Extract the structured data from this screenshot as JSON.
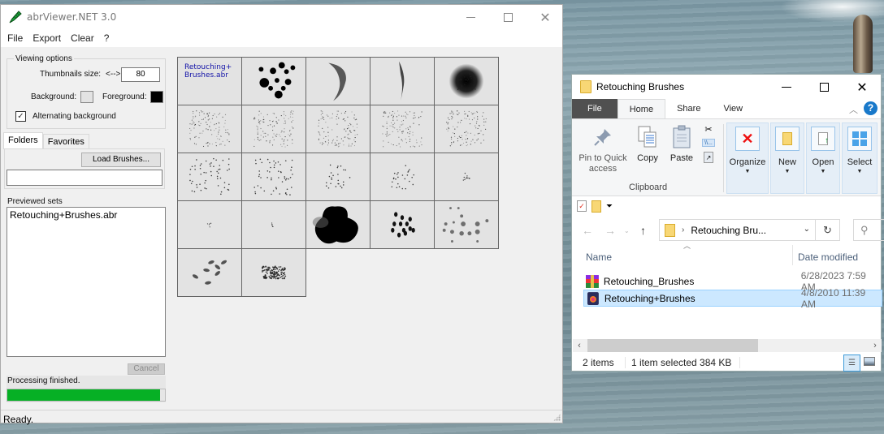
{
  "abr_viewer": {
    "title": "abrViewer.NET 3.0",
    "window_controls": {
      "minimize": "minimize",
      "maximize": "maximize",
      "close": "✕"
    },
    "menu": [
      "File",
      "Export",
      "Clear",
      "?"
    ],
    "viewing_options": {
      "legend": "Viewing options",
      "thumbnails_size_label": "Thumbnails size:",
      "thumbnails_size_arrows": "<-->",
      "thumbnails_size_value": "80",
      "background_label": "Background:",
      "background_color": "#e3e3e3",
      "foreground_label": "Foreground:",
      "foreground_color": "#000000",
      "alternating_label": "Alternating background",
      "alternating_checked": true
    },
    "tabs": [
      "Folders",
      "Favorites"
    ],
    "active_tab": "Folders",
    "load_brushes_label": "Load Brushes...",
    "folder_input_value": "",
    "previewed_sets_label": "Previewed sets",
    "previewed_sets": [
      "Retouching+Brushes.abr"
    ],
    "cancel_label": "Cancel",
    "processing_text": "Processing finished.",
    "progress_percent": 97,
    "status_text": "Ready.",
    "thumbnails": {
      "caption": "Retouching+\nBrushes.abr",
      "caption_line1": "Retouching+",
      "caption_line2": "Brushes.abr",
      "count": 22,
      "brush_types": [
        "caption",
        "dots-large",
        "curved-stroke",
        "thin-stroke",
        "soft-round",
        "scatter-dense",
        "scatter-dense",
        "scatter-dense",
        "scatter-dense",
        "scatter-dense",
        "scatter-medium",
        "scatter-medium",
        "scatter-small",
        "scatter-small",
        "scatter-tiny",
        "scatter-micro",
        "scatter-micro",
        "blob",
        "spots",
        "spots-soft",
        "spots-oval",
        "splatter"
      ]
    }
  },
  "explorer": {
    "title": "Retouching Brushes",
    "window_controls": {
      "minimize": "minimize",
      "maximize": "maximize",
      "close": "✕"
    },
    "ribbon_tabs": [
      "File",
      "Home",
      "Share",
      "View"
    ],
    "active_ribbon_tab": "Home",
    "clipboard": {
      "pin_label_1": "Pin to Quick",
      "pin_label_2": "access",
      "copy_label": "Copy",
      "paste_label": "Paste",
      "group_label": "Clipboard"
    },
    "groups": [
      "Organize",
      "New",
      "Open",
      "Select"
    ],
    "address": "Retouching Bru...",
    "columns": {
      "name": "Name",
      "date": "Date modified"
    },
    "files": [
      {
        "name": "Retouching_Brushes",
        "date": "6/28/2023 7:59 AM",
        "icon": "archive-icon",
        "selected": false
      },
      {
        "name": "Retouching+Brushes",
        "date": "4/8/2010 11:39 AM",
        "icon": "abr-file-icon",
        "selected": true
      }
    ],
    "status": {
      "count": "2 items",
      "selection": "1 item selected  384 KB"
    }
  }
}
